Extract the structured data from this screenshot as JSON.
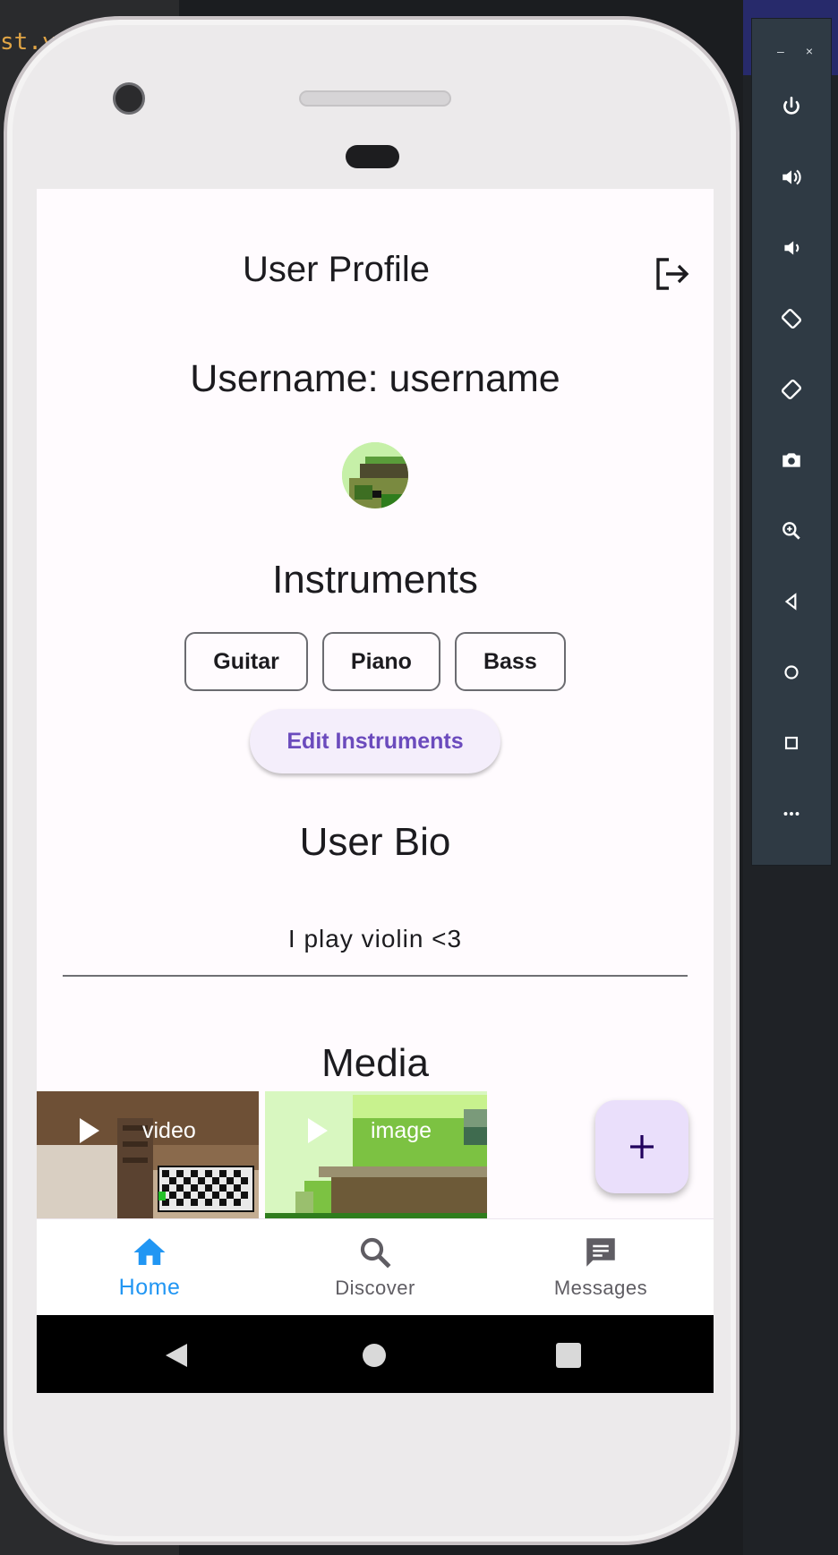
{
  "background": {
    "code_snippet": "st.y"
  },
  "emulator_panel": {
    "minimize_label": "–",
    "close_label": "×",
    "buttons": [
      "power-icon",
      "volume-up-icon",
      "volume-down-icon",
      "rotate-left-icon",
      "rotate-right-icon",
      "camera-icon",
      "zoom-icon",
      "back-icon",
      "home-icon",
      "overview-icon",
      "more-icon"
    ]
  },
  "app": {
    "title": "User Profile",
    "username_line": "Username: username",
    "instruments_title": "Instruments",
    "instruments": [
      "Guitar",
      "Piano",
      "Bass"
    ],
    "edit_instruments_label": "Edit Instruments",
    "bio_title": "User Bio",
    "bio_text": "I play violin <3",
    "media_title": "Media",
    "media": [
      {
        "type_label": "video"
      },
      {
        "type_label": "image"
      }
    ]
  },
  "bottom_nav": {
    "items": [
      {
        "label": "Home",
        "icon": "home-icon",
        "active": true
      },
      {
        "label": "Discover",
        "icon": "search-icon",
        "active": false
      },
      {
        "label": "Messages",
        "icon": "message-icon",
        "active": false
      }
    ]
  },
  "colors": {
    "accent": "#2196f3",
    "primary_purple": "#6b4bbd",
    "fab_bg": "#eadffb",
    "screen_bg": "#fffbfe"
  }
}
